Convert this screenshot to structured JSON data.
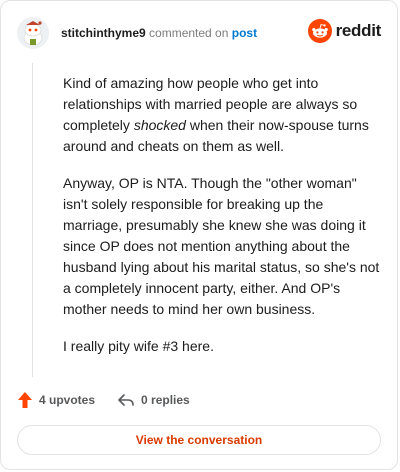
{
  "header": {
    "username": "stitchinthyme9",
    "commented_text": "commented on",
    "post_link": "post",
    "logo_text": "reddit"
  },
  "comment": {
    "p1_before": "Kind of amazing how people who get into relationships with married people are always so completely ",
    "p1_emph": "shocked",
    "p1_after": " when their now-spouse turns around and cheats on them as well.",
    "p2": "Anyway, OP is NTA. Though the \"other woman\" isn't solely responsible for breaking up the marriage, presumably she knew she was doing it since OP does not mention anything about the husband lying about his marital status, so she's not a completely innocent party, either. And OP's mother needs to mind her own business.",
    "p3": "I really pity wife #3 here."
  },
  "actions": {
    "upvotes": "4 upvotes",
    "replies": "0 replies"
  },
  "view_button": "View the conversation",
  "colors": {
    "brand": "#ff4500",
    "link": "#0079d3",
    "cta": "#d93a00"
  }
}
